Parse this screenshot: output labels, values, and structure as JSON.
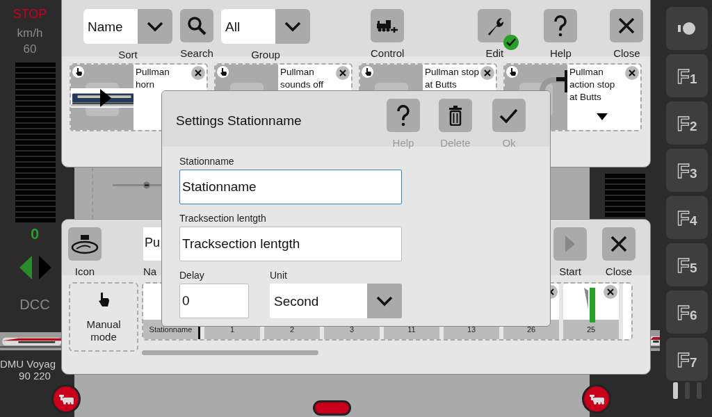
{
  "left_controller": {
    "stop": "STOP",
    "unit": "km/h",
    "max_speed": "60",
    "speed": "0",
    "forward": false,
    "protocol": "DCC",
    "name": "DMU Voyag",
    "address": "90 220"
  },
  "function_buttons": [
    {
      "kind": "light"
    },
    {
      "kind": "function",
      "label": "F1"
    },
    {
      "kind": "function",
      "label": "F2"
    },
    {
      "kind": "function",
      "label": "F3"
    },
    {
      "kind": "function",
      "label": "F4"
    },
    {
      "kind": "function",
      "label": "F5"
    },
    {
      "kind": "function",
      "label": "F6"
    },
    {
      "kind": "function",
      "label": "F7"
    }
  ],
  "actions_panel": {
    "toolbar": [
      {
        "kind": "select",
        "value": "Name",
        "label": "Sort"
      },
      {
        "kind": "search",
        "label": "Search"
      },
      {
        "kind": "select",
        "value": "All",
        "label": "Group"
      },
      {
        "kind": "control",
        "label": "Control"
      },
      {
        "kind": "edit",
        "label": "Edit",
        "active": true
      },
      {
        "kind": "help",
        "label": "Help"
      },
      {
        "kind": "close",
        "label": "Close"
      }
    ],
    "cards": [
      {
        "title": "Pullman horn",
        "kind": "train"
      },
      {
        "title": "Pullman sounds off",
        "kind": "blank"
      },
      {
        "title": "Pullman stop at Butts",
        "kind": "blank"
      },
      {
        "title": "Pullman action stop at Butts",
        "kind": "bumper",
        "expandable": true
      }
    ]
  },
  "sequence_panel": {
    "toolbar": [
      {
        "kind": "icon",
        "label": "Icon"
      },
      {
        "kind": "name",
        "value": "Pu",
        "label": "Na"
      },
      {
        "kind": "start",
        "label": "Start",
        "disabled": true
      },
      {
        "kind": "close",
        "label": "Close"
      }
    ],
    "mode": "Manual mode",
    "stations": [
      {
        "label": "Stationname",
        "kind": "name"
      },
      {
        "label": "1",
        "kind": "station"
      },
      {
        "label": "2",
        "kind": "station"
      },
      {
        "label": "3",
        "kind": "station"
      },
      {
        "label": "11",
        "kind": "station"
      },
      {
        "label": "13",
        "kind": "station"
      },
      {
        "label": "26",
        "kind": "station"
      },
      {
        "label": "25",
        "kind": "signal"
      }
    ]
  },
  "dialog": {
    "title": "Settings Stationname",
    "buttons": [
      {
        "kind": "help",
        "label": "Help",
        "disabled": true
      },
      {
        "kind": "delete",
        "label": "Delete",
        "disabled": true
      },
      {
        "kind": "ok",
        "label": "Ok",
        "disabled": true
      }
    ],
    "fields": [
      {
        "label": "Stationname",
        "value": "Stationname",
        "focused": true
      },
      {
        "label": "Tracksection lentgth",
        "value": "Tracksection lentgth",
        "focused": false
      }
    ],
    "delay": {
      "label": "Delay",
      "value": "0"
    },
    "unit": {
      "label": "Unit",
      "value": "Second"
    }
  }
}
